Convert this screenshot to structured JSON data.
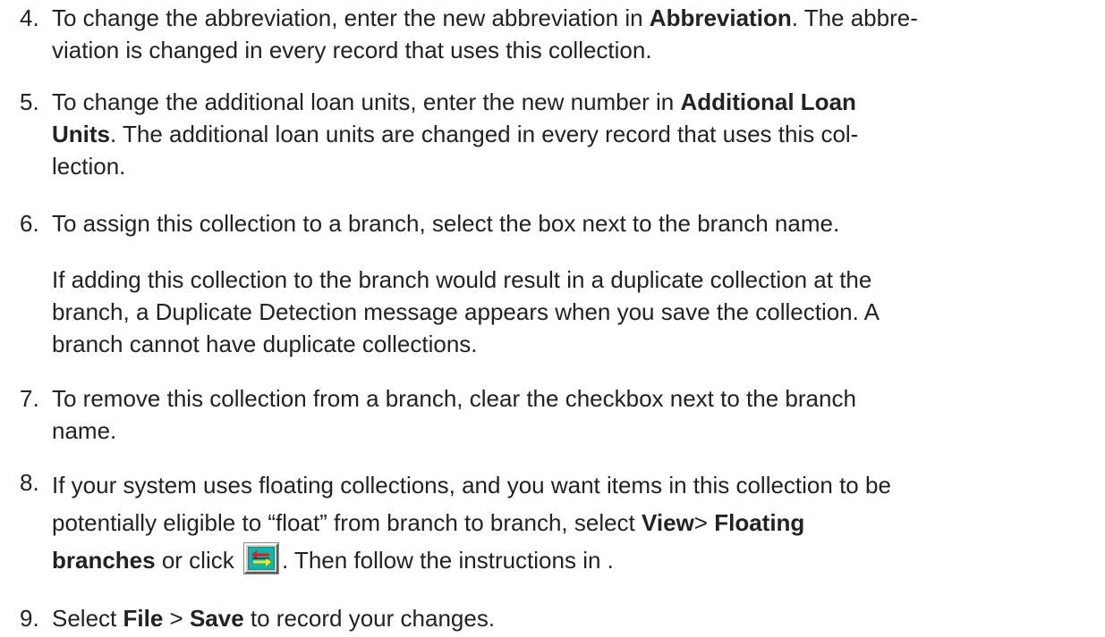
{
  "steps": [
    {
      "number": "4.",
      "parts": [
        {
          "t": "To change the abbreviation, enter the new abbreviation in "
        },
        {
          "b": "Abbreviation"
        },
        {
          "t": ". The abbre-"
        },
        {
          "br": true
        },
        {
          "t": "viation is changed in every record that uses this collection."
        }
      ]
    },
    {
      "number": "5.",
      "parts": [
        {
          "t": "To change the additional loan units, enter the new number in "
        },
        {
          "b": "Additional Loan"
        },
        {
          "br": true
        },
        {
          "b": "Units"
        },
        {
          "t": ". The additional loan units are changed in every record that uses this col-"
        },
        {
          "br": true
        },
        {
          "t": "lection."
        }
      ]
    },
    {
      "number": "6.",
      "parts": [
        {
          "t": "To assign this collection to a branch, select the box next to the branch name."
        }
      ],
      "note_lines": [
        "If adding this collection to the branch would result in a duplicate collection at the",
        "branch, a Duplicate Detection message appears when you save the collection. A",
        "branch cannot have duplicate collections."
      ]
    },
    {
      "number": "7.",
      "parts": [
        {
          "t": "To remove this collection from a branch, clear the checkbox next to the branch"
        },
        {
          "br": true
        },
        {
          "t": "name."
        }
      ]
    },
    {
      "number": "8.",
      "parts": [
        {
          "t": "If your system uses floating collections, and you want items in this collection to be"
        },
        {
          "br": true
        },
        {
          "t": "potentially eligible to “float” from branch to branch, select "
        },
        {
          "b": "View"
        },
        {
          "t": ">  "
        },
        {
          "b": "Floating"
        },
        {
          "br": true
        },
        {
          "b": "branches"
        },
        {
          "t": " or click "
        },
        {
          "icon": "floating-branches-icon"
        },
        {
          "t": ". Then follow the instructions in ."
        }
      ]
    },
    {
      "number": "9.",
      "parts": [
        {
          "t": "Select "
        },
        {
          "b": "File"
        },
        {
          "t": " > "
        },
        {
          "b": "Save"
        },
        {
          "t": " to record your changes."
        }
      ]
    }
  ],
  "colors": {
    "text": "#222222",
    "icon_bg": "#19b0a6",
    "icon_arrow_red": "#d61f26",
    "icon_arrow_yellow": "#f3e61a"
  }
}
